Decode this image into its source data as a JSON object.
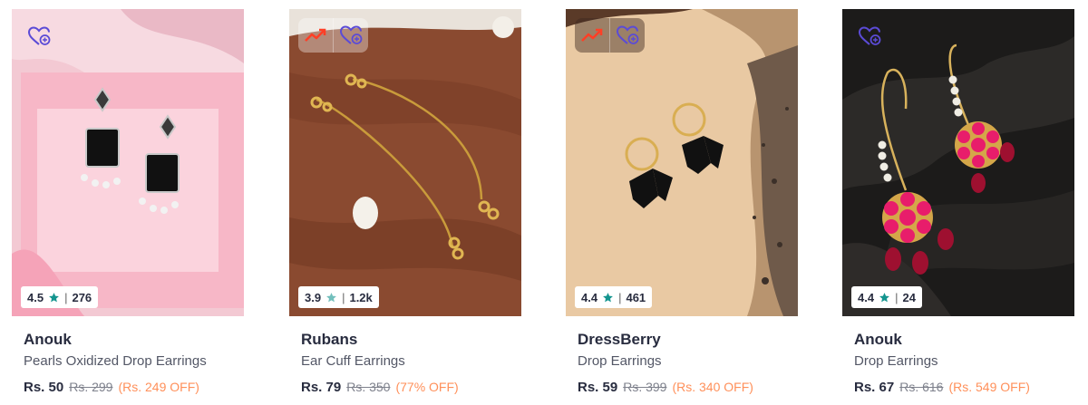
{
  "products": [
    {
      "brand": "Anouk",
      "title": "Pearls Oxidized Drop Earrings",
      "rating": "4.5",
      "reviews": "276",
      "price": "Rs. 50",
      "mrp": "Rs. 299",
      "discount": "(Rs. 249 OFF)",
      "icons": [
        "wishlist-icon"
      ],
      "star_color": "#14958f"
    },
    {
      "brand": "Rubans",
      "title": "Ear Cuff Earrings",
      "rating": "3.9",
      "reviews": "1.2k",
      "price": "Rs. 79",
      "mrp": "Rs. 350",
      "discount": "(77% OFF)",
      "icons": [
        "trending-icon",
        "wishlist-icon"
      ],
      "star_color": "#72bfbc"
    },
    {
      "brand": "DressBerry",
      "title": "Drop Earrings",
      "rating": "4.4",
      "reviews": "461",
      "price": "Rs. 59",
      "mrp": "Rs. 399",
      "discount": "(Rs. 340 OFF)",
      "icons": [
        "trending-icon",
        "wishlist-icon"
      ],
      "star_color": "#14958f"
    },
    {
      "brand": "Anouk",
      "title": "Drop Earrings",
      "rating": "4.4",
      "reviews": "24",
      "price": "Rs. 67",
      "mrp": "Rs. 616",
      "discount": "(Rs. 549 OFF)",
      "icons": [
        "wishlist-icon"
      ],
      "star_color": "#14958f"
    }
  ],
  "colors": {
    "accent_wishlist": "#5b4bd6",
    "trending": "#ff3f26",
    "discount": "#ff905a"
  }
}
